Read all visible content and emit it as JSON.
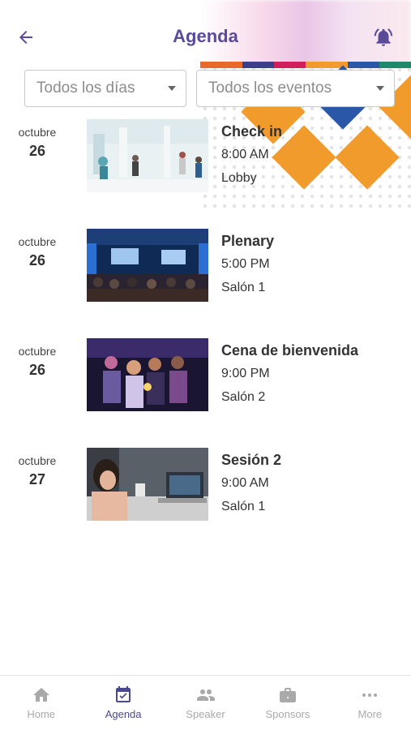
{
  "header": {
    "title": "Agenda"
  },
  "filters": {
    "days_value": "Todos los días",
    "events_value": "Todos los eventos"
  },
  "events": [
    {
      "month": "octubre",
      "day": "26",
      "name": "Check in",
      "time": "8:00 AM",
      "place": "Lobby",
      "image": "lobby-photo"
    },
    {
      "month": "octubre",
      "day": "26",
      "name": "Plenary",
      "time": "5:00 PM",
      "place": "Salón 1",
      "image": "conference-hall-photo"
    },
    {
      "month": "octubre",
      "day": "26",
      "name": "Cena de bienvenida",
      "time": "9:00 PM",
      "place": "Salón 2",
      "image": "party-photo"
    },
    {
      "month": "octubre",
      "day": "27",
      "name": "Sesión 2",
      "time": "9:00 AM",
      "place": "Salón 1",
      "image": "laptop-meeting-photo"
    }
  ],
  "tabbar": {
    "items": [
      {
        "label": "Home",
        "icon": "home-icon",
        "active": false
      },
      {
        "label": "Agenda",
        "icon": "calendar-icon",
        "active": true
      },
      {
        "label": "Speaker",
        "icon": "people-icon",
        "active": false
      },
      {
        "label": "Sponsors",
        "icon": "briefcase-icon",
        "active": false
      },
      {
        "label": "More",
        "icon": "more-icon",
        "active": false
      }
    ]
  },
  "colors": {
    "accent": "#5b4a9a",
    "inactive": "#a9a9a9"
  }
}
